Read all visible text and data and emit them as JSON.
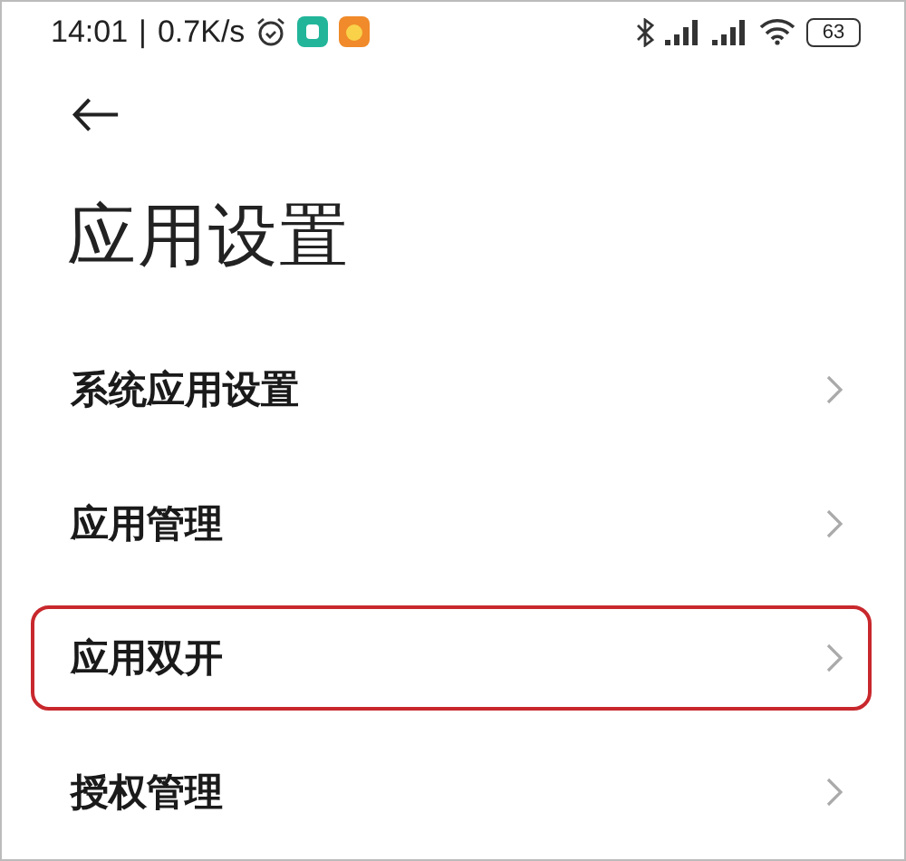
{
  "status_bar": {
    "time": "14:01",
    "separator": "|",
    "speed": "0.7K/s",
    "battery": "63"
  },
  "title": "应用设置",
  "items": [
    {
      "label": "系统应用设置",
      "highlighted": false
    },
    {
      "label": "应用管理",
      "highlighted": false
    },
    {
      "label": "应用双开",
      "highlighted": true
    },
    {
      "label": "授权管理",
      "highlighted": false
    }
  ]
}
